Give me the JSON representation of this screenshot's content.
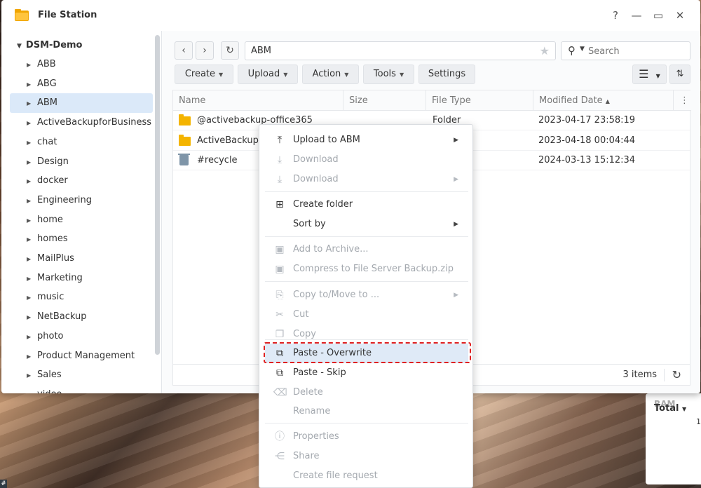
{
  "window": {
    "title": "File Station",
    "help": "?",
    "minimize": "—",
    "maximize": "▭",
    "close": "✕"
  },
  "sidebar": {
    "root": "DSM-Demo",
    "items": [
      {
        "label": "ABB"
      },
      {
        "label": "ABG"
      },
      {
        "label": "ABM"
      },
      {
        "label": "ActiveBackupforBusiness"
      },
      {
        "label": "chat"
      },
      {
        "label": "Design"
      },
      {
        "label": "docker"
      },
      {
        "label": "Engineering"
      },
      {
        "label": "home"
      },
      {
        "label": "homes"
      },
      {
        "label": "MailPlus"
      },
      {
        "label": "Marketing"
      },
      {
        "label": "music"
      },
      {
        "label": "NetBackup"
      },
      {
        "label": "photo"
      },
      {
        "label": "Product Management"
      },
      {
        "label": "Sales"
      },
      {
        "label": "video"
      }
    ],
    "selected_index": 2
  },
  "nav": {
    "back": "‹",
    "forward": "›",
    "refresh": "↻",
    "path": "ABM",
    "star": "★"
  },
  "search": {
    "placeholder": "Search"
  },
  "toolbar": {
    "create": "Create",
    "upload": "Upload",
    "action": "Action",
    "tools": "Tools",
    "settings": "Settings"
  },
  "list": {
    "columns": [
      "Name",
      "Size",
      "File Type",
      "Modified Date"
    ],
    "rows": [
      {
        "name": "@activebackup-office365",
        "size": "",
        "type": "Folder",
        "modified": "2023-04-17 23:58:19",
        "icon": "folder-icon"
      },
      {
        "name": "ActiveBackupF",
        "size": "",
        "type": "",
        "modified": "2023-04-18 00:04:44",
        "icon": "folder-icon"
      },
      {
        "name": "#recycle",
        "size": "",
        "type": "",
        "modified": "2024-03-13 15:12:34",
        "icon": "trash-icon"
      }
    ],
    "count": "3 items"
  },
  "context_menu": {
    "items": [
      {
        "label": "Upload to ABM",
        "disabled": false,
        "submenu": true
      },
      {
        "label": "Download",
        "disabled": true,
        "submenu": false
      },
      {
        "label": "Download",
        "disabled": true,
        "submenu": true
      },
      {
        "label": "Create folder",
        "disabled": false,
        "submenu": false
      },
      {
        "label": "Sort by",
        "disabled": false,
        "submenu": true
      },
      {
        "label": "Add to Archive...",
        "disabled": true,
        "submenu": false
      },
      {
        "label": "Compress to File Server Backup.zip",
        "disabled": true,
        "submenu": false
      },
      {
        "label": "Copy to/Move to ...",
        "disabled": true,
        "submenu": true
      },
      {
        "label": "Cut",
        "disabled": true,
        "submenu": false
      },
      {
        "label": "Copy",
        "disabled": true,
        "submenu": false
      },
      {
        "label": "Paste - Overwrite",
        "disabled": false,
        "submenu": false
      },
      {
        "label": "Paste - Skip",
        "disabled": false,
        "submenu": false
      },
      {
        "label": "Delete",
        "disabled": true,
        "submenu": false
      },
      {
        "label": "Rename",
        "disabled": true,
        "submenu": false
      },
      {
        "label": "Properties",
        "disabled": true,
        "submenu": false
      },
      {
        "label": "Share",
        "disabled": true,
        "submenu": false
      },
      {
        "label": "Create file request",
        "disabled": true,
        "submenu": false
      }
    ]
  },
  "widget": {
    "line1": "RAM",
    "line2": "Total",
    "line3": "1"
  },
  "colors": {
    "accent": "#dbe9f9",
    "highlight": "#e02020",
    "folder": "#f4b400"
  }
}
